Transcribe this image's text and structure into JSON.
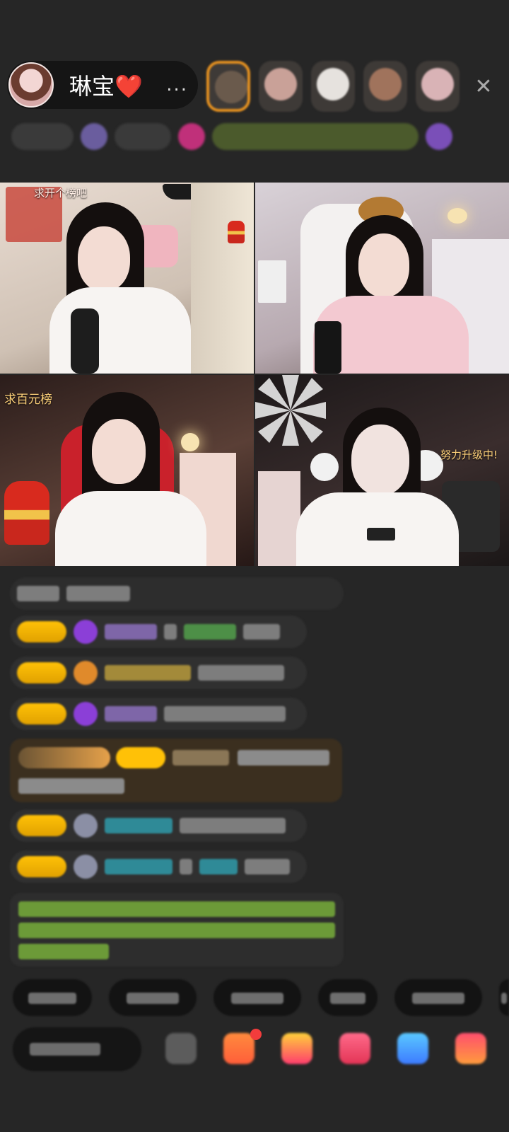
{
  "header": {
    "host_name": "琳宝❤️",
    "more_label": "...",
    "guest_avatar_count": 5,
    "close_label": "✕"
  },
  "video_tiles": [
    {
      "id": "tile-1",
      "overlay_text": "求开个榜吧"
    },
    {
      "id": "tile-2",
      "overlay_text": ""
    },
    {
      "id": "tile-3",
      "overlay_text": "求百元榜"
    },
    {
      "id": "tile-4",
      "overlay_text": "努力升级中!"
    }
  ],
  "colors": {
    "background": "#262626",
    "level_badge": "#ffc107",
    "chat_bubble": "#303030",
    "notice_green": "#6c9a38"
  }
}
